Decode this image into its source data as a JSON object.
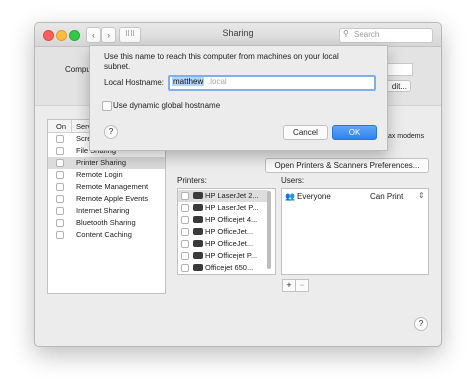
{
  "window": {
    "title": "Sharing",
    "search_placeholder": "Search"
  },
  "background": {
    "computer_label": "Compu",
    "edit_label": "dit...",
    "fax_text": "fax modems"
  },
  "services": {
    "col_on": "On",
    "col_service": "Serv",
    "items": [
      {
        "label": "Scre",
        "selected": false
      },
      {
        "label": "File Sharing",
        "selected": false
      },
      {
        "label": "Printer Sharing",
        "selected": true
      },
      {
        "label": "Remote Login",
        "selected": false
      },
      {
        "label": "Remote Management",
        "selected": false
      },
      {
        "label": "Remote Apple Events",
        "selected": false
      },
      {
        "label": "Internet Sharing",
        "selected": false
      },
      {
        "label": "Bluetooth Sharing",
        "selected": false
      },
      {
        "label": "Content Caching",
        "selected": false
      }
    ]
  },
  "open_printers_button": "Open Printers & Scanners Preferences...",
  "printers": {
    "label": "Printers:",
    "items": [
      {
        "name": "HP LaserJet 2...",
        "selected": true
      },
      {
        "name": "HP LaserJet P...",
        "selected": false
      },
      {
        "name": "HP Officejet 4...",
        "selected": false
      },
      {
        "name": "HP OfficeJet...",
        "selected": false
      },
      {
        "name": "HP OfficeJet...",
        "selected": false
      },
      {
        "name": "HP Officejet P...",
        "selected": false
      },
      {
        "name": "Officejet 650...",
        "selected": false
      }
    ]
  },
  "users": {
    "label": "Users:",
    "items": [
      {
        "name": "Everyone",
        "permission": "Can Print"
      }
    ],
    "add_label": "+",
    "remove_label": "−"
  },
  "help_label": "?",
  "sheet": {
    "message": "Use this name to reach this computer from machines on your local subnet.",
    "hostname_label": "Local Hostname:",
    "hostname_value": "matthew",
    "hostname_suffix": ".local",
    "dynamic_label": "Use dynamic global hostname",
    "help_label": "?",
    "cancel_label": "Cancel",
    "ok_label": "OK"
  },
  "colors": {
    "accent": "#2f82ee",
    "selection": "#b4d5fe"
  }
}
